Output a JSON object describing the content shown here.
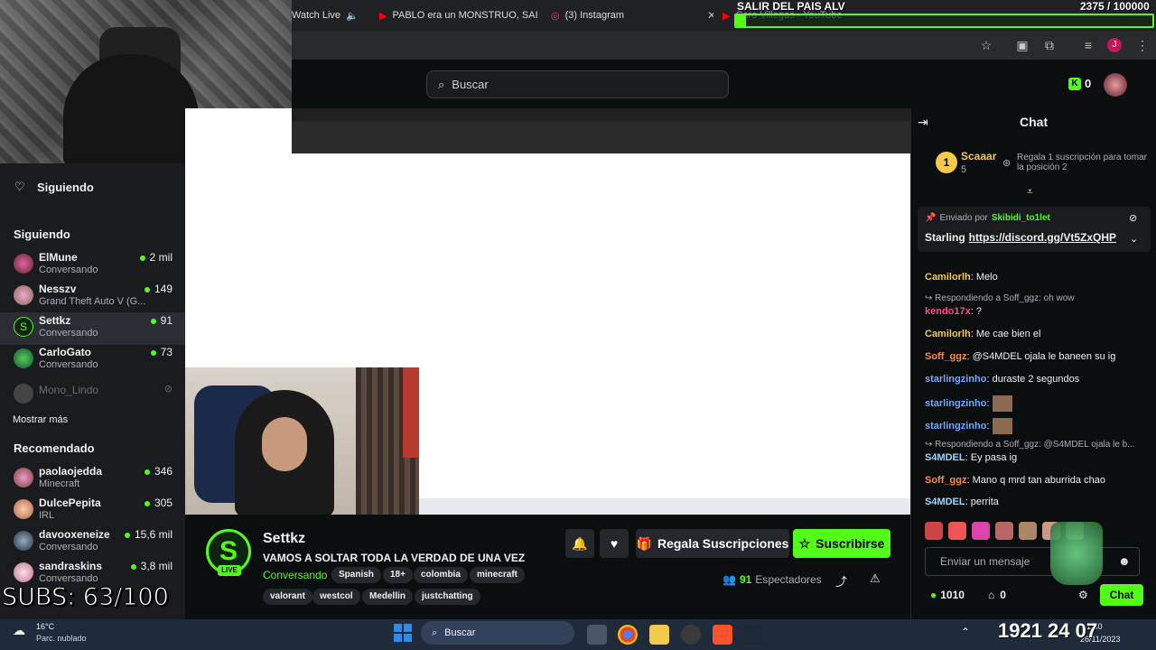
{
  "browser": {
    "tabs": [
      {
        "label": "Watch Live"
      },
      {
        "label": "PABLO era un MONSTRUO, SAI"
      },
      {
        "label": "(3) Instagram"
      },
      {
        "label": "Caro Villegas - YouTube"
      }
    ]
  },
  "header": {
    "search_placeholder": "Buscar",
    "kicks_count": "0"
  },
  "sidebar": {
    "following_title": "Siguiendo",
    "following_section": "Siguiendo",
    "following": [
      {
        "name": "ElMune",
        "sub": "Conversando",
        "viewers": "2 mil"
      },
      {
        "name": "Nesszv",
        "sub": "Grand Theft Auto V (G...",
        "viewers": "149"
      },
      {
        "name": "Settkz",
        "sub": "Conversando",
        "viewers": "91"
      },
      {
        "name": "CarloGato",
        "sub": "Conversando",
        "viewers": "73"
      },
      {
        "name": "Mono_Lindo",
        "sub": "",
        "viewers": ""
      }
    ],
    "show_more": "Mostrar más",
    "recommended_section": "Recomendado",
    "recommended": [
      {
        "name": "paolaojedda",
        "sub": "Minecraft",
        "viewers": "346"
      },
      {
        "name": "DulcePepita",
        "sub": "IRL",
        "viewers": "305"
      },
      {
        "name": "davooxeneize",
        "sub": "Conversando",
        "viewers": "15,6 mil"
      },
      {
        "name": "sandraskins",
        "sub": "Conversando",
        "viewers": "3,8 mil"
      }
    ]
  },
  "stream": {
    "channel_name": "Settkz",
    "title": "VAMOS A SOLTAR TODA LA VERDAD DE UNA VEZ",
    "category": "Conversando",
    "live_label": "LIVE",
    "tags": [
      "Spanish",
      "18+",
      "colombia",
      "minecraft",
      "valorant",
      "westcol",
      "Medellin",
      "justchatting"
    ],
    "gift_label": "Regala Suscripciones",
    "subscribe_label": "Suscribirse",
    "viewers": "91",
    "viewers_label": "Espectadores"
  },
  "chat": {
    "title": "Chat",
    "top_gifter": {
      "name": "Scaaar",
      "count": "5",
      "rank": "1"
    },
    "gift_prompt": "Regala 1 suscripción para tomar la posición 2",
    "pinned_by_prefix": "Enviado por",
    "pinned_by": "Skibidi_to1let",
    "pinned_user": "Starling",
    "pinned_link": "https://discord.gg/Vt5ZxQHP",
    "messages": [
      {
        "user": "Camilorlh",
        "text": "Melo",
        "color": "#f5c94b"
      },
      {
        "reply": "Respondiendo a Soff_ggz: oh wow"
      },
      {
        "user": "kendo17x",
        "text": "?",
        "color": "#ff4b8b"
      },
      {
        "user": "Camilorlh",
        "text": "Me cae bien el",
        "color": "#f5c94b"
      },
      {
        "user": "Soff_ggz",
        "text": "@S4MDEL ojala le baneen su ig",
        "color": "#ff8a3d"
      },
      {
        "user": "starlingzinho",
        "text": "duraste 2 segundos",
        "color": "#6fa8ff"
      },
      {
        "user": "starlingzinho",
        "text": "",
        "color": "#6fa8ff"
      },
      {
        "user": "starlingzinho",
        "text": "",
        "color": "#6fa8ff"
      },
      {
        "reply": "Respondiendo a Soff_ggz: @S4MDEL ojala le b..."
      },
      {
        "user": "S4MDEL",
        "text": "Ey pasa ig",
        "color": "#9ad4ff"
      },
      {
        "user": "Soff_ggz",
        "text": "Mano q mrd tan aburrida chao",
        "color": "#ff8a3d"
      },
      {
        "user": "S4MDEL",
        "text": "perrita",
        "color": "#9ad4ff"
      }
    ],
    "input_placeholder": "Enviar un mensaje",
    "points": "1010",
    "kicks": "0",
    "send_label": "Chat"
  },
  "overlay": {
    "subs_text": "SUBS: 63/100",
    "goal_title": "SALIR DEL PAIS ALV",
    "goal_count": "2375 / 100000",
    "goal_fraction": 0.024,
    "clock": "1921 24 07"
  },
  "taskbar": {
    "weather_temp": "16°C",
    "weather_desc": "Parc. nublado",
    "search": "Buscar",
    "time": "1:30",
    "date": "26/11/2023"
  },
  "colors": {
    "accent": "#53fc18"
  }
}
